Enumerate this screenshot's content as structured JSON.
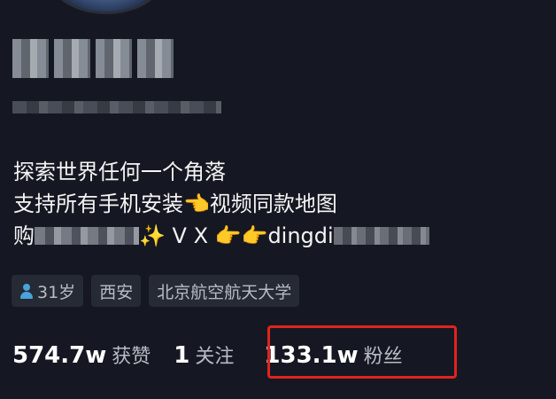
{
  "profile": {
    "bio_line1": "探索世界任何一个角落",
    "bio_line2_text": "支持所有手机安装",
    "bio_line2_emoji": "👈",
    "bio_line2_tail": "视频同款地图",
    "bio_line3_start": "购",
    "bio_line3_sparkle": "✨",
    "bio_line3_vx": "V X",
    "bio_line3_pointers": "👉👉",
    "bio_line3_id": "dingdi"
  },
  "tags": {
    "age": "31岁",
    "city": "西安",
    "school": "北京航空航天大学"
  },
  "stats": {
    "likes_value": "574.7w",
    "likes_label": "获赞",
    "following_value": "1",
    "following_label": "关注",
    "followers_value": "133.1w",
    "followers_label": "粉丝"
  },
  "colors": {
    "background": "#151822",
    "highlight": "#e0231f",
    "age_icon": "#4aa3d8"
  },
  "icons": {
    "age": "person-icon"
  }
}
